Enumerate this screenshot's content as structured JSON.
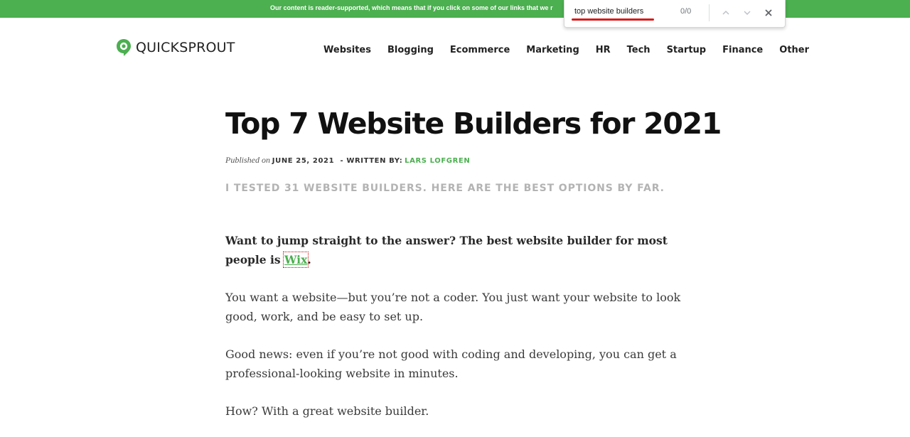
{
  "banner": {
    "text": "Our content is reader-supported, which means that if you click on some of our links that we r"
  },
  "find_bar": {
    "query": "top website builders",
    "count": "0/0",
    "icons": {
      "prev": "chevron-up-icon",
      "next": "chevron-down-icon",
      "close": "close-icon"
    },
    "underline_color": "#d81b1b"
  },
  "header": {
    "logo_text": "QUICKSPROUT",
    "brand_color": "#4caf50",
    "nav": [
      "Websites",
      "Blogging",
      "Ecommerce",
      "Marketing",
      "HR",
      "Tech",
      "Startup",
      "Finance",
      "Other"
    ]
  },
  "article": {
    "title": "Top 7 Website Builders for 2021",
    "published_prefix": "Published on",
    "date": "JUNE 25, 2021",
    "written_by": "- WRITTEN BY:",
    "author": "LARS LOFGREN",
    "subtitle": "I TESTED 31 WEBSITE BUILDERS. HERE ARE THE BEST OPTIONS BY FAR.",
    "intro_text": "Want to jump straight to the answer? The best website builder for most people is",
    "intro_link": "Wix",
    "intro_end": ".",
    "paragraphs": [
      "You want a website—but you’re not a coder. You just want your website to look good, work, and be easy to set up.",
      "Good news: even if you’re not good with coding and developing, you can get a professional-looking website in minutes.",
      "How? With a great website builder."
    ]
  }
}
